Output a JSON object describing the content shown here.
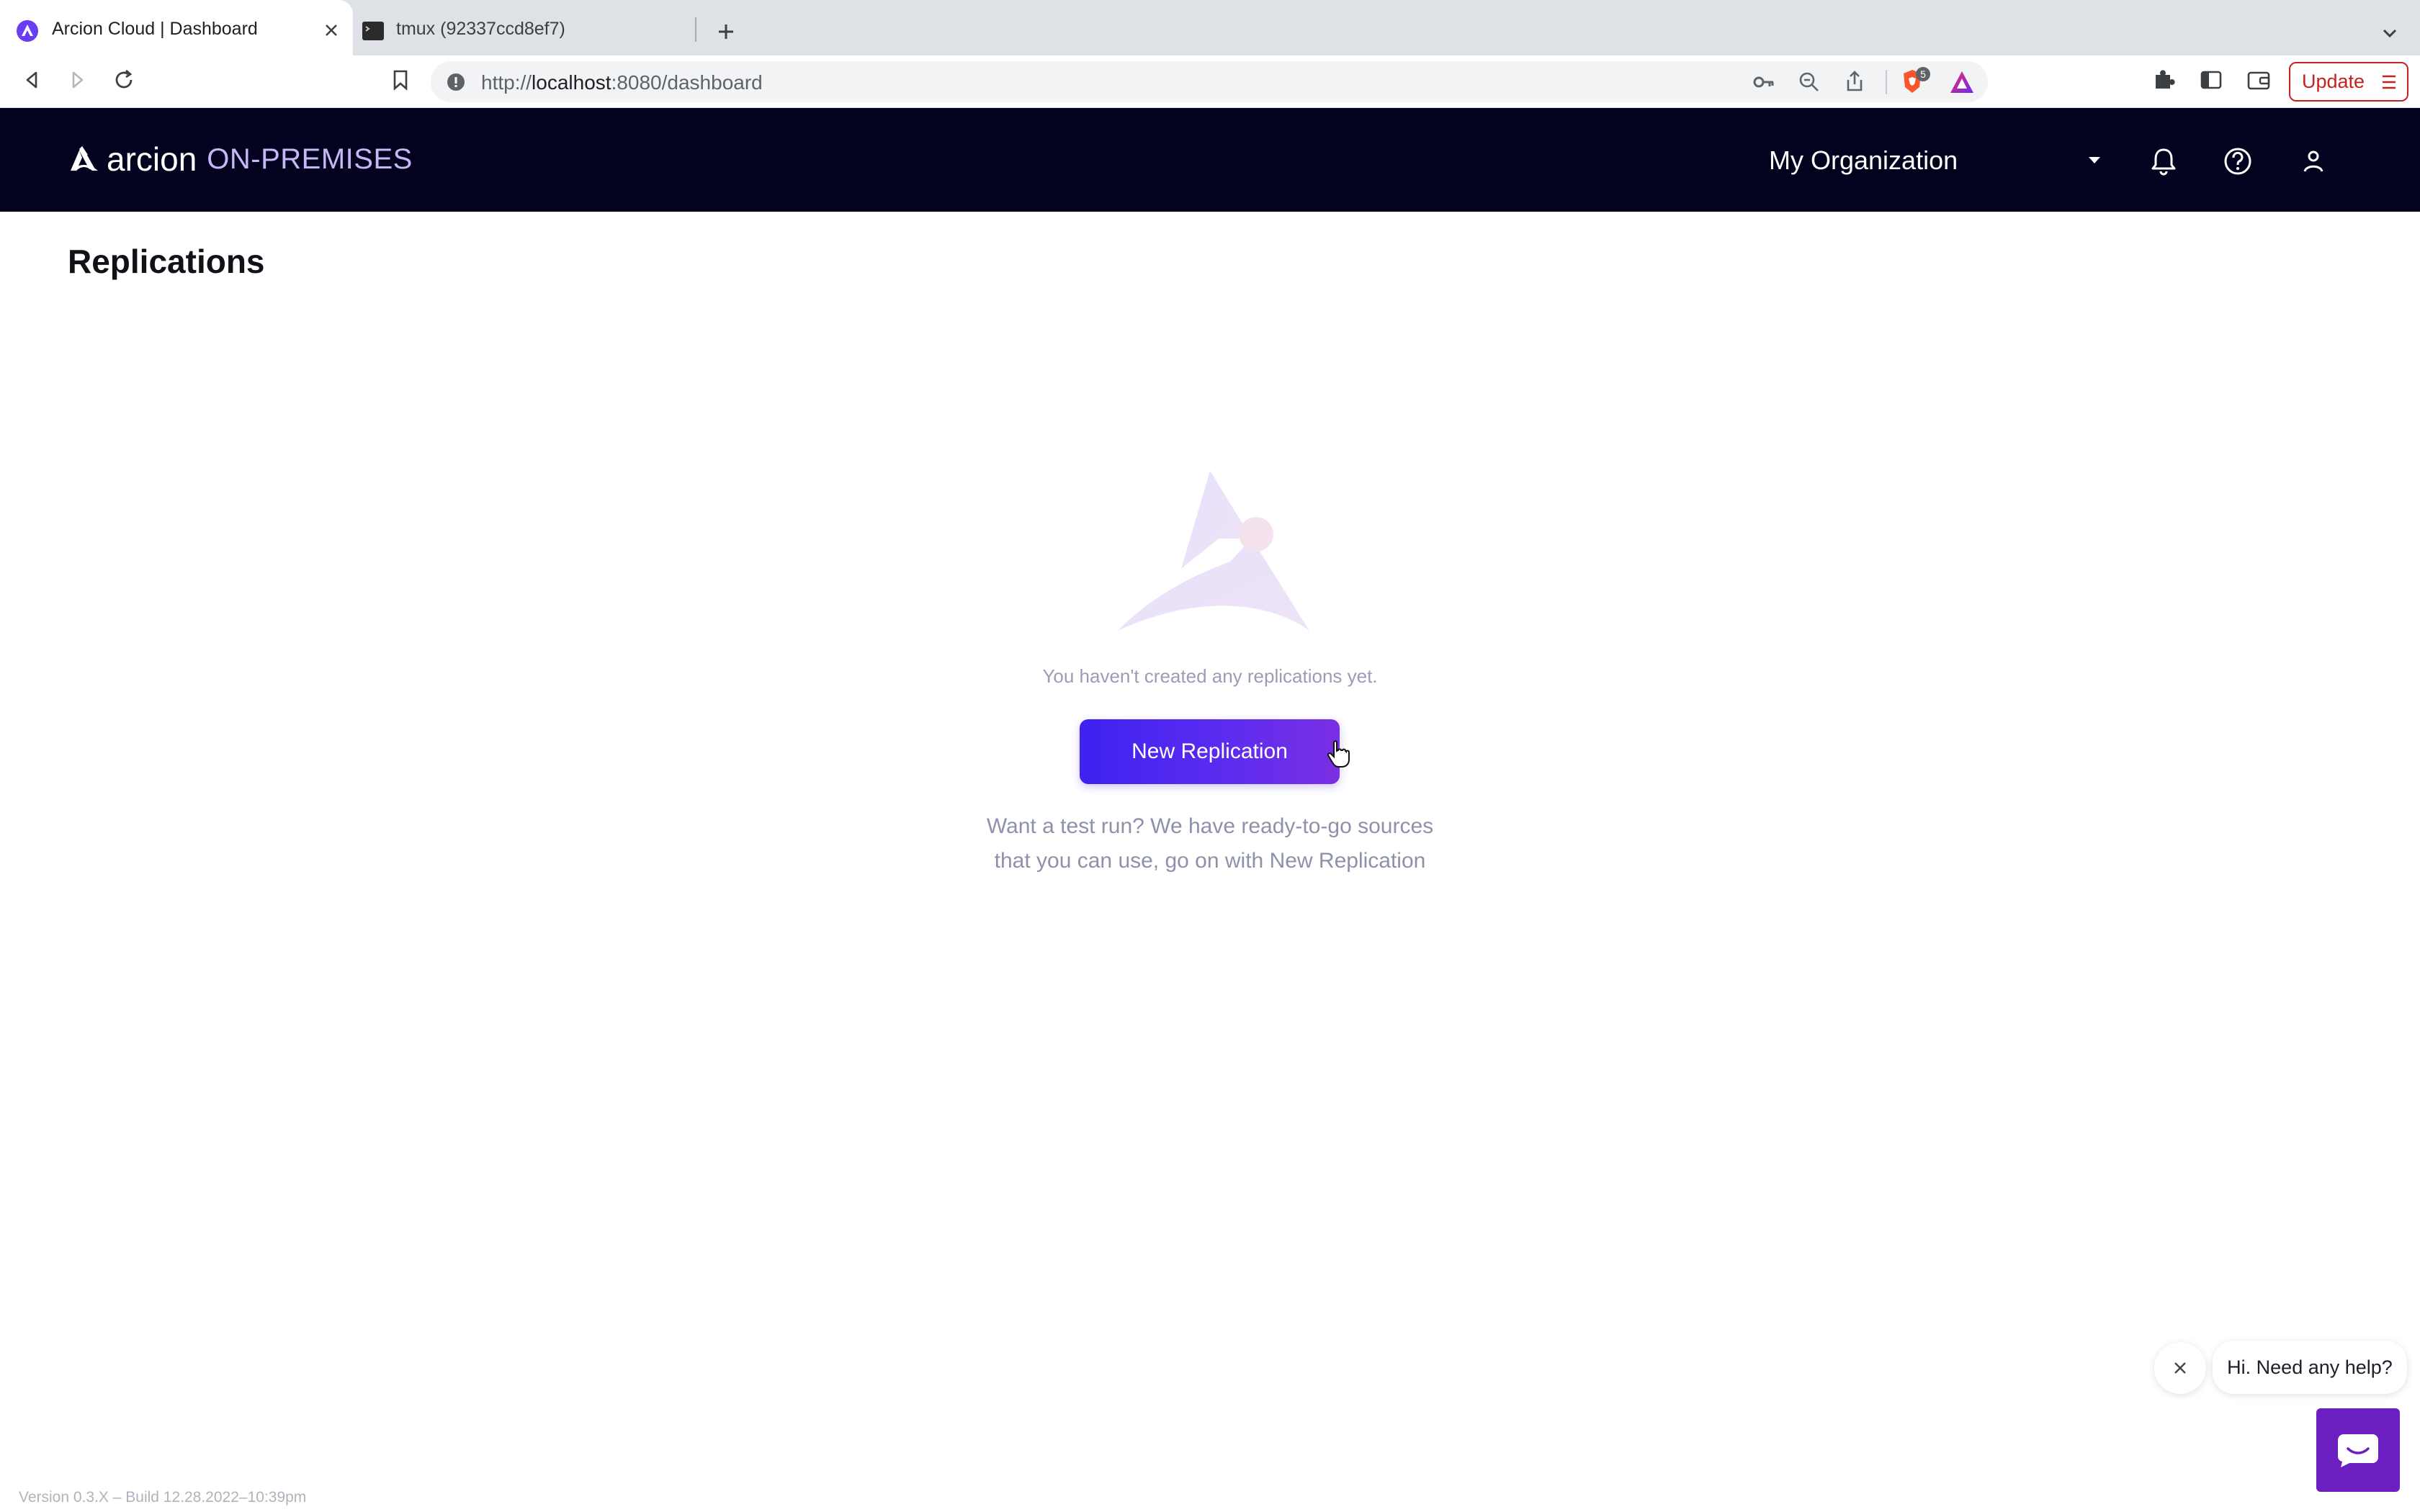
{
  "browser": {
    "tabs": [
      {
        "title": "Arcion Cloud | Dashboard",
        "active": true,
        "icon": "arcion-favicon"
      },
      {
        "title": "tmux (92337ccd8ef7)",
        "active": false,
        "icon": "terminal-favicon"
      }
    ],
    "url_scheme": "http://",
    "url_host": "localhost",
    "url_path": ":8080/dashboard",
    "extension_badge": "5",
    "update_label": "Update"
  },
  "app": {
    "brand": "arcion",
    "brand_sub": "ON-PREMISES",
    "organization": "My Organization"
  },
  "page": {
    "title": "Replications",
    "empty_message": "You haven't created any replications yet.",
    "primary_button": "New Replication",
    "hint_line1": "Want a test run? We have ready-to-go sources",
    "hint_line2": "that you can use, go on with New Replication",
    "version": "Version 0.3.X – Build 12.28.2022–10:39pm"
  },
  "help": {
    "bubble": "Hi. Need any help?"
  },
  "colors": {
    "header_bg": "#03021f",
    "primary_start": "#3d22f0",
    "primary_end": "#7a2fe3",
    "help_launcher": "#6b1fc0"
  }
}
